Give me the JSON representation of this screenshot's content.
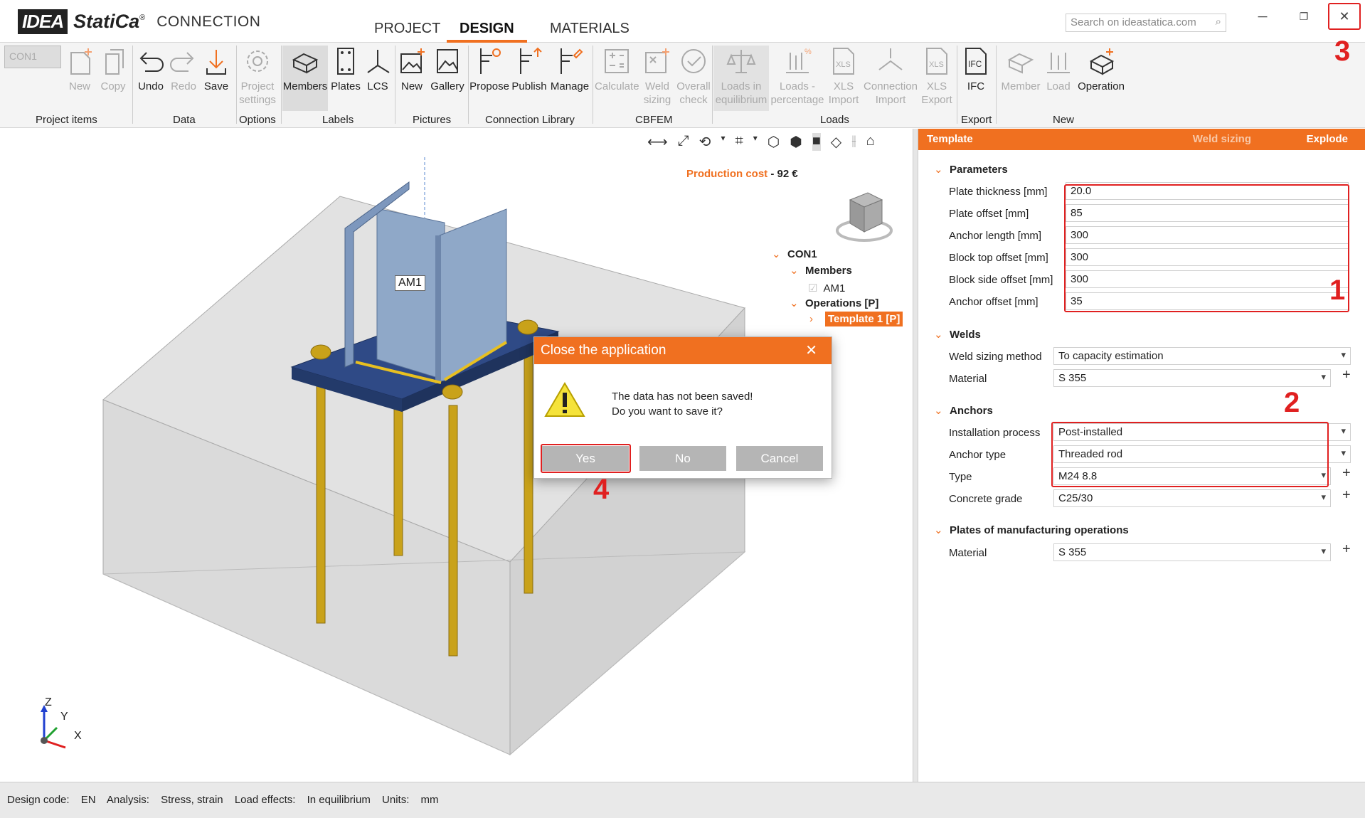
{
  "app": {
    "logo_box": "IDEA",
    "logo_brand": "StatiCa",
    "logo_reg": "®",
    "product": "CONNECTION"
  },
  "menu_tabs": [
    "PROJECT",
    "DESIGN",
    "MATERIALS"
  ],
  "search_placeholder": "Search on ideastatica.com",
  "window_buttons": {
    "minimize": "─",
    "restore": "❐",
    "close": "✕"
  },
  "ribbon": {
    "combo": "CON1",
    "buttons": {
      "new": "New",
      "copy": "Copy",
      "undo": "Undo",
      "redo": "Redo",
      "save": "Save",
      "project_settings_1": "Project",
      "project_settings_2": "settings",
      "members": "Members",
      "plates": "Plates",
      "lcs": "LCS",
      "pic_new": "New",
      "gallery": "Gallery",
      "propose": "Propose",
      "publish": "Publish",
      "manage": "Manage",
      "calculate": "Calculate",
      "weld_sizing_1": "Weld",
      "weld_sizing_2": "sizing",
      "overall_check_1": "Overall",
      "overall_check_2": "check",
      "loads_eq_1": "Loads in",
      "loads_eq_2": "equilibrium",
      "loads_pct_1": "Loads -",
      "loads_pct_2": "percentage",
      "xls_import_1": "XLS",
      "xls_import_2": "Import",
      "conn_import_1": "Connection",
      "conn_import_2": "Import",
      "xls_export_1": "XLS",
      "xls_export_2": "Export",
      "ifc": "IFC",
      "member": "Member",
      "load": "Load",
      "operation": "Operation"
    },
    "groups": {
      "project_items": "Project items",
      "data": "Data",
      "options": "Options",
      "labels": "Labels",
      "pictures": "Pictures",
      "connection_library": "Connection Library",
      "cbfem": "CBFEM",
      "loads": "Loads",
      "export": "Export",
      "new": "New"
    }
  },
  "viewport": {
    "production_cost_label": "Production cost",
    "production_cost_sep": " - ",
    "production_cost_value": "92 €",
    "member_label": "AM1",
    "axes": {
      "z": "Z",
      "y": "Y",
      "x": "X"
    }
  },
  "tree": {
    "root": "CON1",
    "members": "Members",
    "member_item": "AM1",
    "operations": "Operations [P]",
    "template": "Template 1 [P]"
  },
  "panel": {
    "header": "Template",
    "weld_sizing": "Weld sizing",
    "explode": "Explode",
    "sections": {
      "parameters": "Parameters",
      "welds": "Welds",
      "anchors": "Anchors",
      "plates": "Plates of manufacturing operations"
    },
    "parameters": [
      {
        "label": "Plate thickness [mm]",
        "value": "20.0"
      },
      {
        "label": "Plate offset [mm]",
        "value": "85"
      },
      {
        "label": "Anchor length [mm]",
        "value": "300"
      },
      {
        "label": "Block top offset [mm]",
        "value": "300"
      },
      {
        "label": "Block side offset [mm]",
        "value": "300"
      },
      {
        "label": "Anchor offset [mm]",
        "value": "35"
      }
    ],
    "welds": {
      "method_label": "Weld sizing method",
      "method_value": "To capacity estimation",
      "material_label": "Material",
      "material_value": "S 355"
    },
    "anchors": {
      "process_label": "Installation process",
      "process_value": "Post-installed",
      "type_label": "Anchor type",
      "type_value": "Threaded rod",
      "size_label": "Type",
      "size_value": "M24 8.8",
      "grade_label": "Concrete grade",
      "grade_value": "C25/30"
    },
    "plates": {
      "material_label": "Material",
      "material_value": "S 355"
    }
  },
  "annotations": {
    "n1": "1",
    "n2": "2",
    "n3": "3",
    "n4": "4",
    "accent": "#e02020"
  },
  "dialog": {
    "title": "Close the application",
    "line1": "The data has not been saved!",
    "line2": "Do you want to save it?",
    "yes": "Yes",
    "no": "No",
    "cancel": "Cancel",
    "icon": "warning-icon"
  },
  "status": {
    "design_code_label": "Design code:",
    "design_code": "EN",
    "analysis_label": "Analysis:",
    "analysis": "Stress, strain",
    "load_effects_label": "Load effects:",
    "load_effects": "In equilibrium",
    "units_label": "Units:",
    "units": "mm"
  },
  "colors": {
    "accent": "#f07020",
    "plate": "#2f4a86",
    "steel": "#8fa8c8",
    "bolt": "#c9a21a",
    "concrete": "#d6d6d6"
  }
}
